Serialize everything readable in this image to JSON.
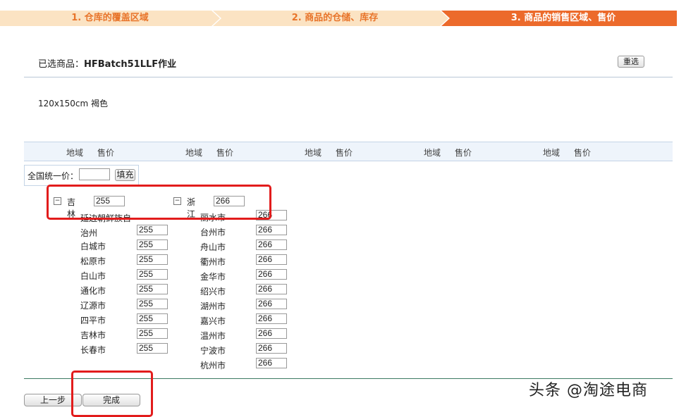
{
  "steps": [
    {
      "label": "1. 仓库的覆盖区域"
    },
    {
      "label": "2. 商品的仓储、库存"
    },
    {
      "label": "3. 商品的销售区域、售价"
    }
  ],
  "header": {
    "selected_label": "已选商品：",
    "product_name": "HFBatch51LLF作业",
    "reselect_label": "重选"
  },
  "sku": "120x150cm 褐色",
  "columns": {
    "region": "地域",
    "price": "售价"
  },
  "unify": {
    "label": "全国统一价：",
    "value": "",
    "fill_label": "填充"
  },
  "provinces": [
    {
      "name": "吉林",
      "price": "255",
      "cities": [
        {
          "name": "延边朝鲜族自治州",
          "price": "255"
        },
        {
          "name": "白城市",
          "price": "255"
        },
        {
          "name": "松原市",
          "price": "255"
        },
        {
          "name": "白山市",
          "price": "255"
        },
        {
          "name": "通化市",
          "price": "255"
        },
        {
          "name": "辽源市",
          "price": "255"
        },
        {
          "name": "四平市",
          "price": "255"
        },
        {
          "name": "吉林市",
          "price": "255"
        },
        {
          "name": "长春市",
          "price": "255"
        }
      ]
    },
    {
      "name": "浙江",
      "price": "266",
      "cities": [
        {
          "name": "丽水市",
          "price": "266"
        },
        {
          "name": "台州市",
          "price": "266"
        },
        {
          "name": "舟山市",
          "price": "266"
        },
        {
          "name": "衢州市",
          "price": "266"
        },
        {
          "name": "金华市",
          "price": "266"
        },
        {
          "name": "绍兴市",
          "price": "266"
        },
        {
          "name": "湖州市",
          "price": "266"
        },
        {
          "name": "嘉兴市",
          "price": "266"
        },
        {
          "name": "温州市",
          "price": "266"
        },
        {
          "name": "宁波市",
          "price": "266"
        },
        {
          "name": "杭州市",
          "price": "266"
        }
      ]
    }
  ],
  "footer": {
    "prev_label": "上一步",
    "done_label": "完成"
  },
  "watermark": "头条 @淘途电商",
  "colors": {
    "active_step": "#ec6a2b",
    "inactive_step": "#fbe3c3",
    "highlight": "#e21c1c"
  }
}
